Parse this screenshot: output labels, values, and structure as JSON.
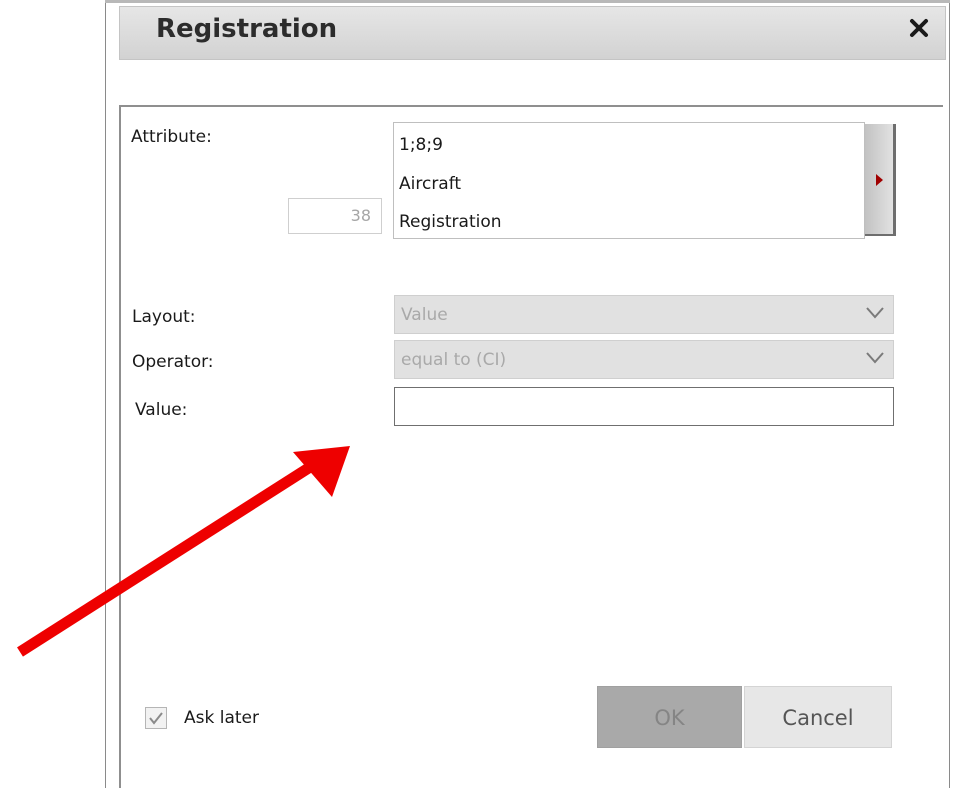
{
  "dialog": {
    "title": "Registration",
    "close_icon": "close-icon"
  },
  "attribute": {
    "label": "Attribute:",
    "id_value": "38",
    "lines": [
      "1;8;9",
      "Aircraft",
      "Registration"
    ],
    "expand_icon": "triangle-right-icon"
  },
  "layout": {
    "label": "Layout:",
    "selected": "Value"
  },
  "operator": {
    "label": "Operator:",
    "selected": "equal to (CI)"
  },
  "value": {
    "label": "Value:",
    "current": ""
  },
  "ask_later": {
    "label": "Ask later",
    "checked": true
  },
  "buttons": {
    "ok": "OK",
    "cancel": "Cancel"
  },
  "colors": {
    "annotation_arrow": "#ee0000",
    "expand_arrow": "#a00000"
  }
}
